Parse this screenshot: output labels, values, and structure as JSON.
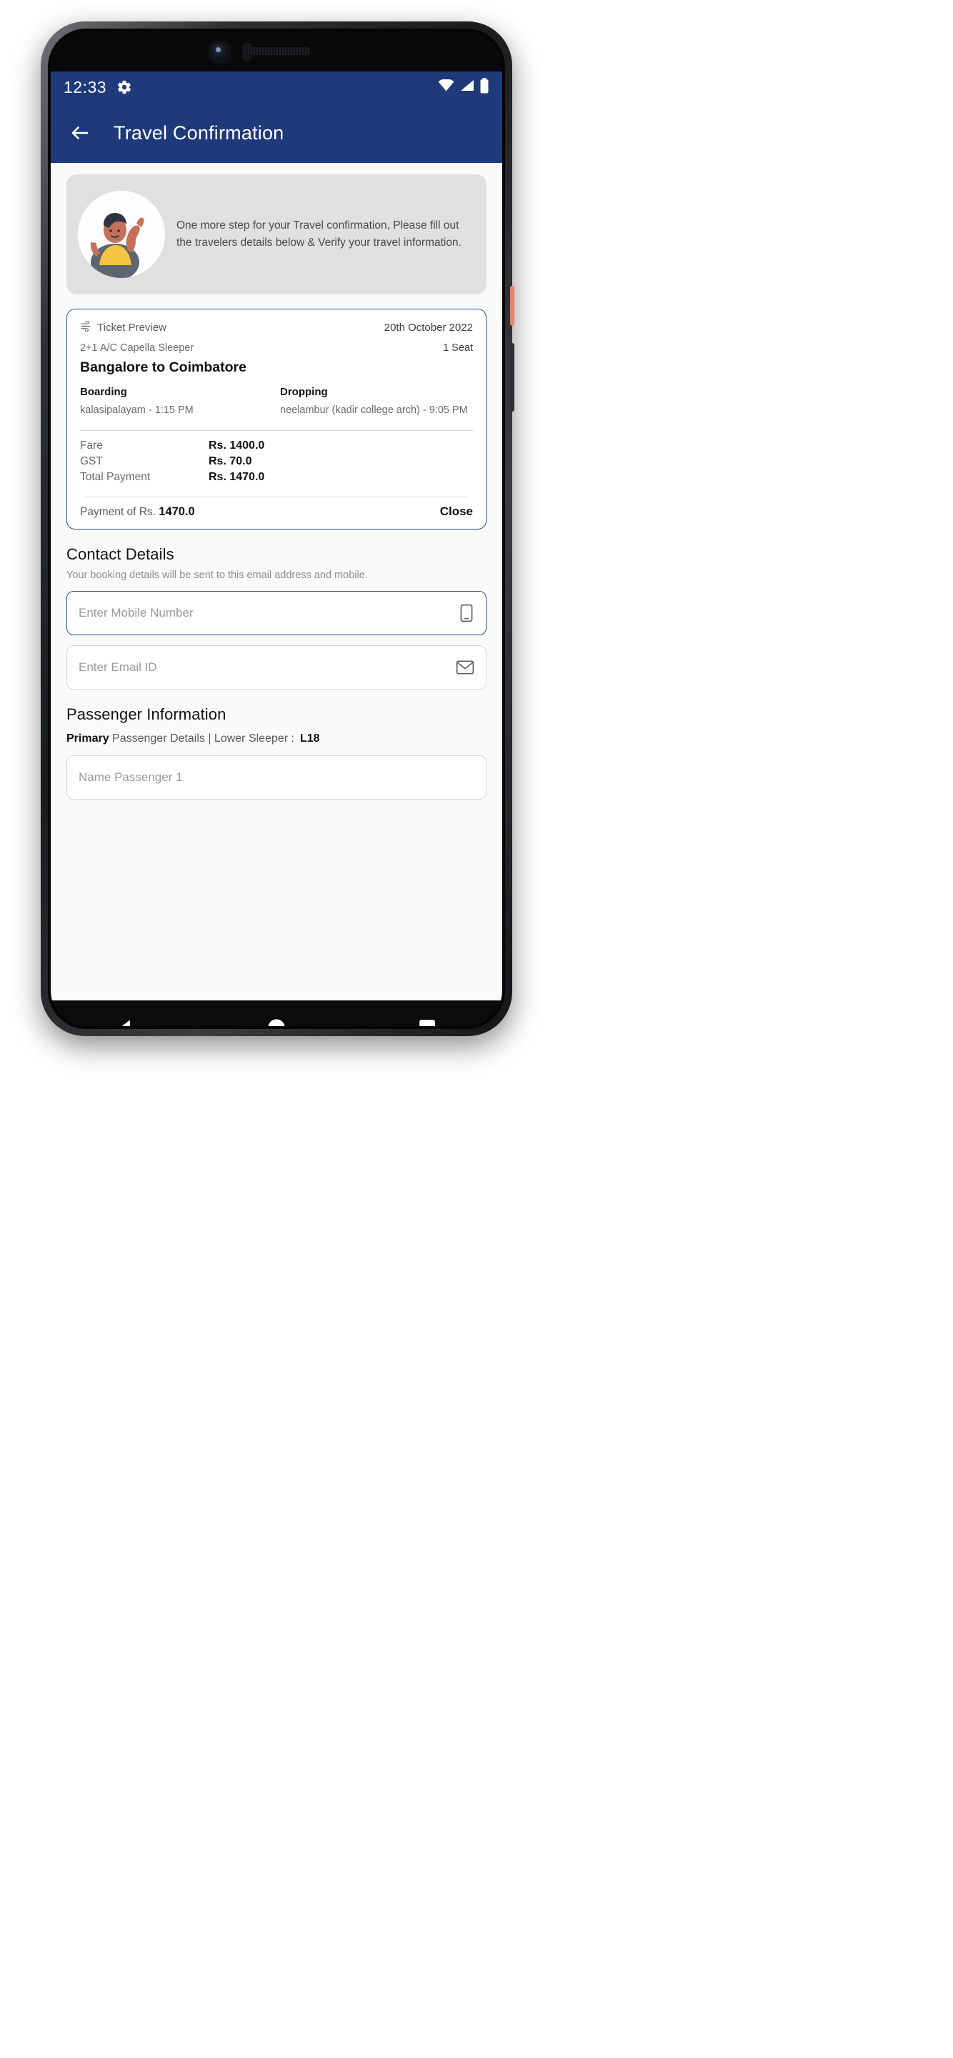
{
  "status_bar": {
    "time": "12:33",
    "gear_icon": "gear-icon",
    "wifi_icon": "wifi-icon",
    "signal_icon": "cellular-signal-icon",
    "battery_icon": "battery-full-icon"
  },
  "app_bar": {
    "back_icon": "back-arrow-icon",
    "title": "Travel Confirmation"
  },
  "banner": {
    "avatar_icon": "waving-person-illustration",
    "message": "One more step for your Travel confirmation, Please fill out the travelers details below & Verify your travel information."
  },
  "ticket": {
    "preview_label": "Ticket Preview",
    "ac_icon": "air-conditioning-icon",
    "date": "20th October 2022",
    "bus_type": "2+1 A/C Capella Sleeper",
    "seats": "1 Seat",
    "route": "Bangalore to Coimbatore",
    "boarding_label": "Boarding",
    "boarding_value": "kalasipalayam - 1:15 PM",
    "dropping_label": "Dropping",
    "dropping_value": "neelambur (kadir college arch) - 9:05 PM",
    "fare_rows": [
      {
        "label": "Fare",
        "value": "Rs. 1400.0"
      },
      {
        "label": "GST",
        "value": "Rs. 70.0"
      },
      {
        "label": "Total Payment",
        "value": "Rs. 1470.0"
      }
    ],
    "payment_prefix": "Payment of Rs. ",
    "payment_amount": "1470.0",
    "close_label": "Close"
  },
  "contact": {
    "title": "Contact Details",
    "subtitle": "Your booking details will be sent to this email address and mobile.",
    "mobile_placeholder": "Enter Mobile Number",
    "mobile_icon": "mobile-phone-icon",
    "email_placeholder": "Enter Email ID",
    "email_icon": "envelope-icon"
  },
  "passenger": {
    "title": "Passenger Information",
    "primary_label": "Primary",
    "detail_text": " Passenger Details | Lower Sleeper :",
    "seat_number": "L18",
    "name_placeholder": "Name Passenger 1"
  },
  "nav_bar": {
    "back_icon": "nav-back-triangle-icon",
    "home_icon": "nav-home-circle-icon",
    "recents_icon": "nav-recents-square-icon"
  },
  "colors": {
    "primary_blue": "#1e3a7a",
    "card_border": "#2f4b9b",
    "page_bg": "#fafafa",
    "banner_bg": "#e0e0e0"
  }
}
